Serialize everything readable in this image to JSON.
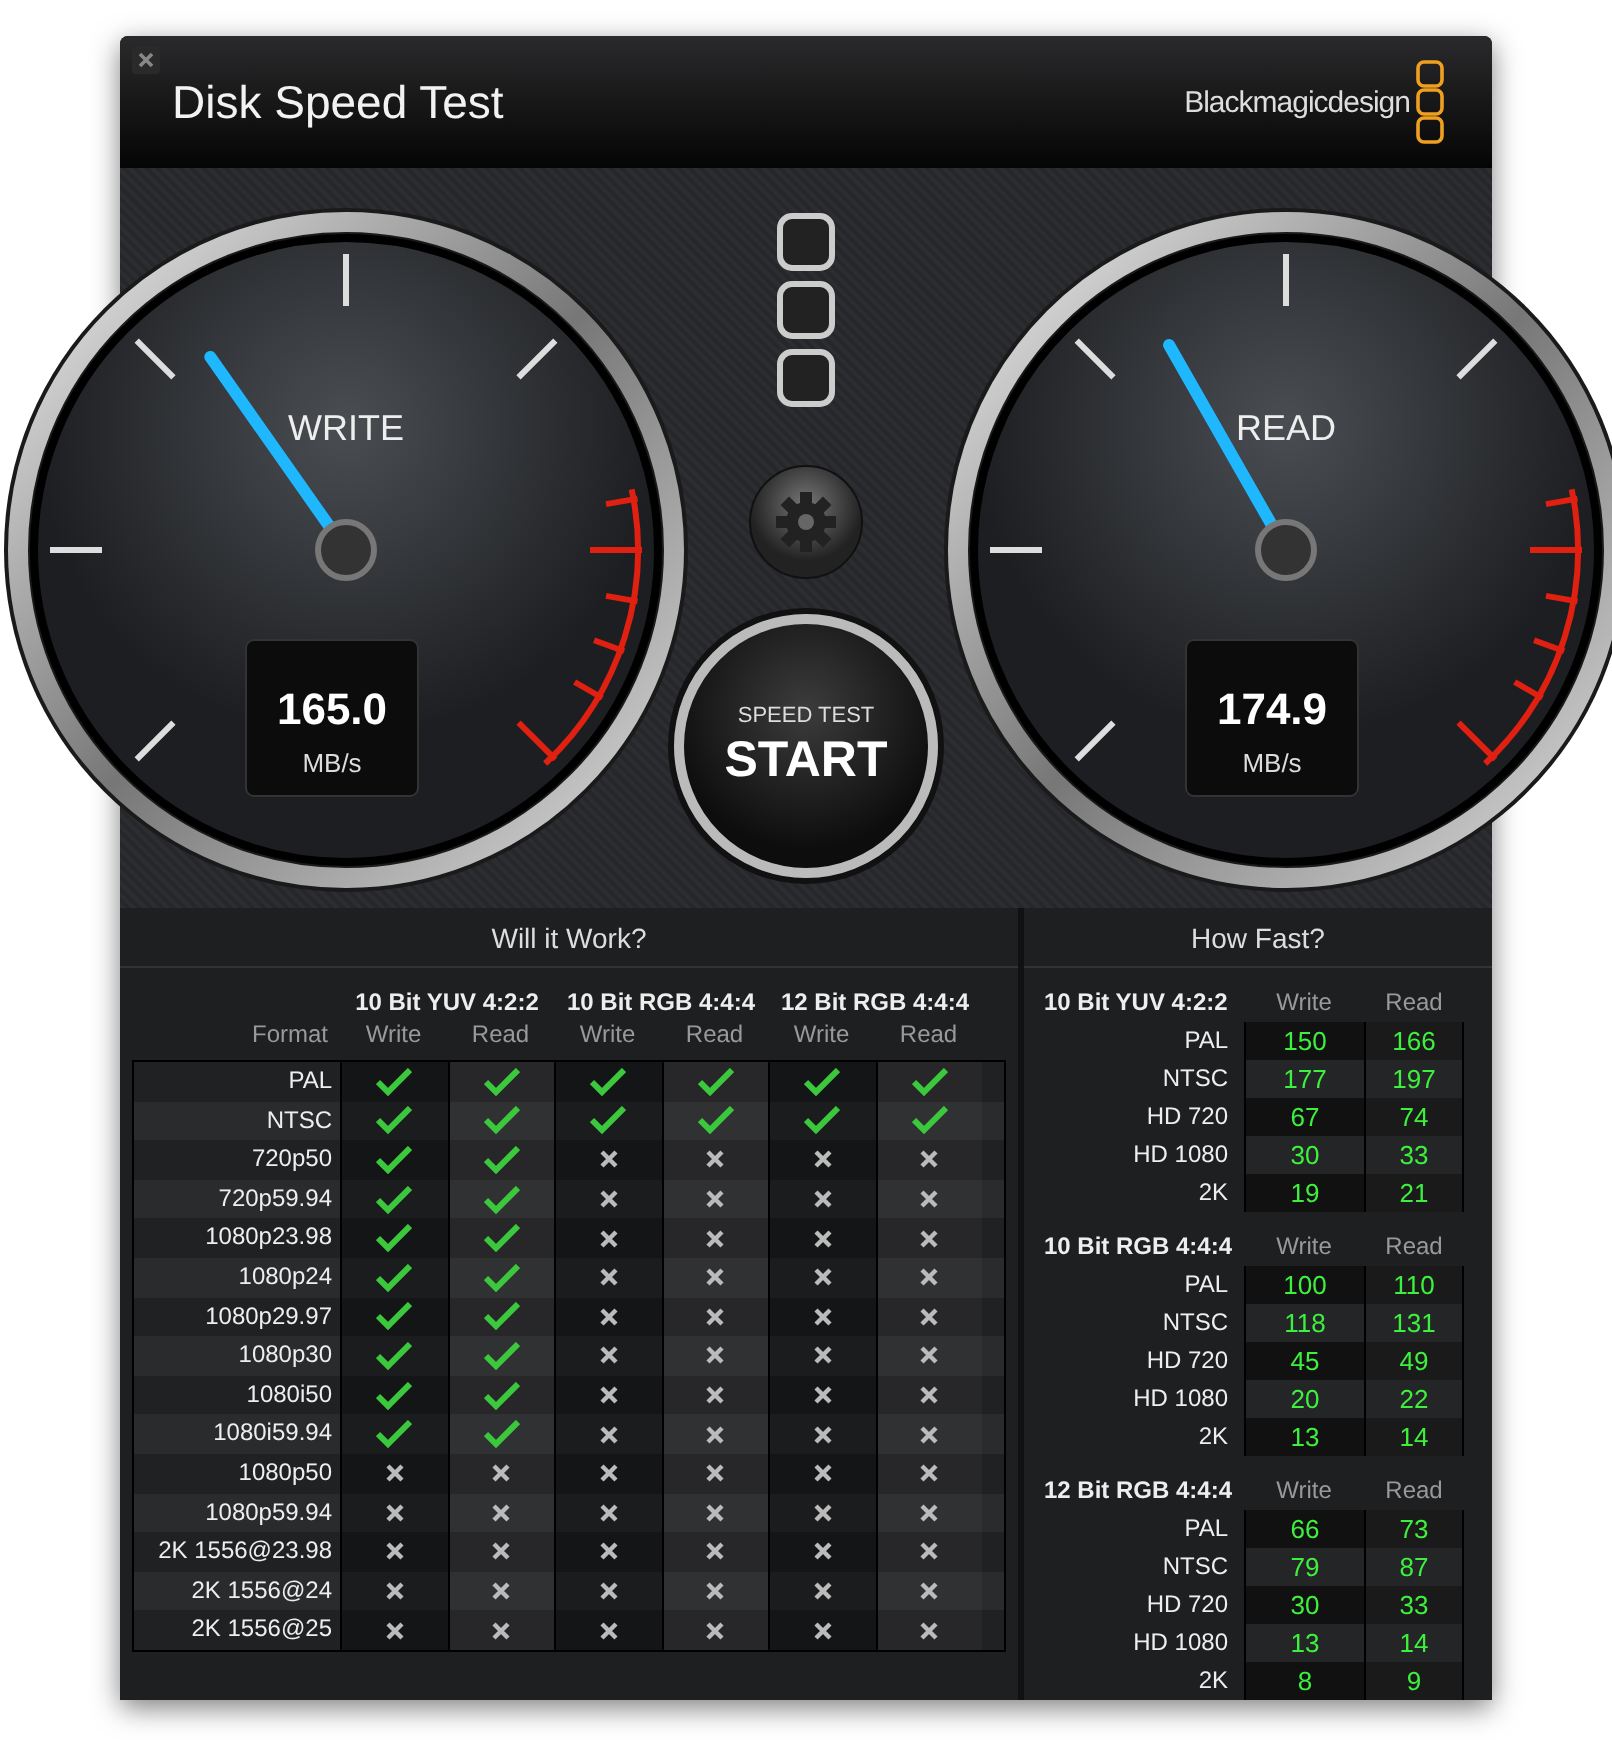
{
  "window": {
    "title": "Disk Speed Test",
    "brand": "Blackmagicdesign"
  },
  "gauges": [
    {
      "label": "WRITE",
      "value": "165.0",
      "unit": "MB/s",
      "level": 0.37
    },
    {
      "label": "READ",
      "value": "174.9",
      "unit": "MB/s",
      "level": 0.39
    }
  ],
  "start_button": {
    "caption": "SPEED TEST",
    "label": "START"
  },
  "will_it_work": {
    "title": "Will it Work?",
    "format_header": "Format",
    "groups": [
      "10 Bit YUV 4:2:2",
      "10 Bit RGB 4:4:4",
      "12 Bit RGB 4:4:4"
    ],
    "subheaders": [
      "Write",
      "Read",
      "Write",
      "Read",
      "Write",
      "Read"
    ],
    "rows": [
      {
        "format": "PAL",
        "works": [
          true,
          true,
          true,
          true,
          true,
          true
        ]
      },
      {
        "format": "NTSC",
        "works": [
          true,
          true,
          true,
          true,
          true,
          true
        ]
      },
      {
        "format": "720p50",
        "works": [
          true,
          true,
          false,
          false,
          false,
          false
        ]
      },
      {
        "format": "720p59.94",
        "works": [
          true,
          true,
          false,
          false,
          false,
          false
        ]
      },
      {
        "format": "1080p23.98",
        "works": [
          true,
          true,
          false,
          false,
          false,
          false
        ]
      },
      {
        "format": "1080p24",
        "works": [
          true,
          true,
          false,
          false,
          false,
          false
        ]
      },
      {
        "format": "1080p29.97",
        "works": [
          true,
          true,
          false,
          false,
          false,
          false
        ]
      },
      {
        "format": "1080p30",
        "works": [
          true,
          true,
          false,
          false,
          false,
          false
        ]
      },
      {
        "format": "1080i50",
        "works": [
          true,
          true,
          false,
          false,
          false,
          false
        ]
      },
      {
        "format": "1080i59.94",
        "works": [
          true,
          true,
          false,
          false,
          false,
          false
        ]
      },
      {
        "format": "1080p50",
        "works": [
          false,
          false,
          false,
          false,
          false,
          false
        ]
      },
      {
        "format": "1080p59.94",
        "works": [
          false,
          false,
          false,
          false,
          false,
          false
        ]
      },
      {
        "format": "2K 1556@23.98",
        "works": [
          false,
          false,
          false,
          false,
          false,
          false
        ]
      },
      {
        "format": "2K 1556@24",
        "works": [
          false,
          false,
          false,
          false,
          false,
          false
        ]
      },
      {
        "format": "2K 1556@25",
        "works": [
          false,
          false,
          false,
          false,
          false,
          false
        ]
      }
    ]
  },
  "how_fast": {
    "title": "How Fast?",
    "groups": [
      {
        "name": "10 Bit YUV 4:2:2",
        "write_header": "Write",
        "read_header": "Read",
        "rows": [
          {
            "format": "PAL",
            "write": "150",
            "read": "166"
          },
          {
            "format": "NTSC",
            "write": "177",
            "read": "197"
          },
          {
            "format": "HD 720",
            "write": "67",
            "read": "74"
          },
          {
            "format": "HD 1080",
            "write": "30",
            "read": "33"
          },
          {
            "format": "2K",
            "write": "19",
            "read": "21"
          }
        ]
      },
      {
        "name": "10 Bit RGB 4:4:4",
        "write_header": "Write",
        "read_header": "Read",
        "rows": [
          {
            "format": "PAL",
            "write": "100",
            "read": "110"
          },
          {
            "format": "NTSC",
            "write": "118",
            "read": "131"
          },
          {
            "format": "HD 720",
            "write": "45",
            "read": "49"
          },
          {
            "format": "HD 1080",
            "write": "20",
            "read": "22"
          },
          {
            "format": "2K",
            "write": "13",
            "read": "14"
          }
        ]
      },
      {
        "name": "12 Bit RGB 4:4:4",
        "write_header": "Write",
        "read_header": "Read",
        "rows": [
          {
            "format": "PAL",
            "write": "66",
            "read": "73"
          },
          {
            "format": "NTSC",
            "write": "79",
            "read": "87"
          },
          {
            "format": "HD 720",
            "write": "30",
            "read": "33"
          },
          {
            "format": "HD 1080",
            "write": "13",
            "read": "14"
          },
          {
            "format": "2K",
            "write": "8",
            "read": "9"
          }
        ]
      }
    ]
  }
}
